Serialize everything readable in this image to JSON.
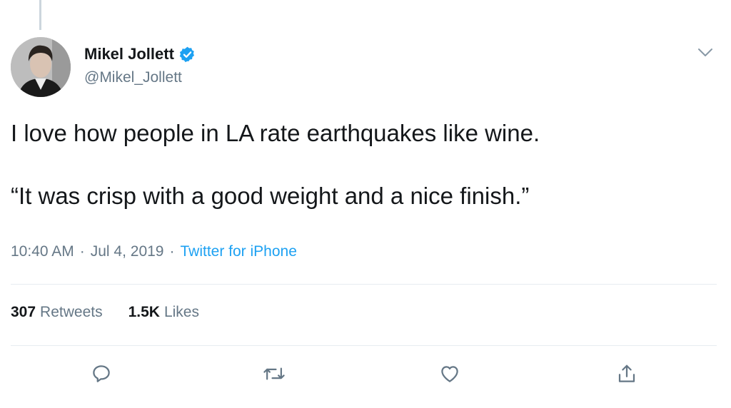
{
  "author": {
    "display_name": "Mikel Jollett",
    "handle": "@Mikel_Jollett",
    "verified": true
  },
  "tweet": {
    "text": "I love how people in LA rate earthquakes like wine.\n\n“It was crisp with a good weight and a nice finish.”",
    "time": "10:40 AM",
    "date": "Jul 4, 2019",
    "separator": "·",
    "source": "Twitter for iPhone"
  },
  "stats": {
    "retweets_count": "307",
    "retweets_label": "Retweets",
    "likes_count": "1.5K",
    "likes_label": "Likes"
  },
  "colors": {
    "text": "#14171a",
    "secondary": "#657786",
    "accent": "#1da1f2",
    "divider": "#e6ecf0"
  },
  "icons": {
    "verified": "verified-badge-icon",
    "caret": "chevron-down-icon",
    "reply": "reply-icon",
    "retweet": "retweet-icon",
    "like": "heart-icon",
    "share": "share-icon"
  }
}
